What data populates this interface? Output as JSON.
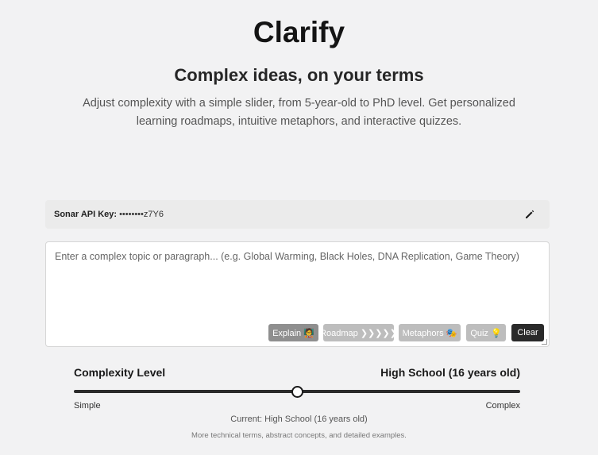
{
  "header": {
    "title": "Clarify",
    "headline": "Complex ideas, on your terms",
    "subtitle": "Adjust complexity with a simple slider, from 5-year-old to PhD level. Get personalized learning roadmaps, intuitive metaphors, and interactive quizzes."
  },
  "api": {
    "label": "Sonar API Key:",
    "masked_value": "••••••••z7Y6",
    "edit_icon": "pencil-icon"
  },
  "topic": {
    "placeholder": "Enter a complex topic or paragraph... (e.g. Global Warming, Black Holes, DNA Replication, Game Theory)",
    "value": ""
  },
  "actions": {
    "explain": "Explain 🧑‍🏫",
    "roadmap": "Roadmap ❯❯❯❯❯",
    "metaphors": "Metaphors 🎭",
    "quiz": "Quiz 💡",
    "clear": "Clear"
  },
  "complexity": {
    "label": "Complexity Level",
    "level": "High School (16 years old)",
    "slider_fraction": 0.5,
    "min_label": "Simple",
    "max_label": "Complex",
    "current": "Current: High School (16 years old)",
    "description": "More technical terms, abstract concepts, and detailed examples."
  },
  "colors": {
    "background": "#f2f2f3",
    "primary_dark": "#2a2a2a",
    "button_disabled": "#bdbdbd",
    "button_muted": "#8f8f8f"
  }
}
